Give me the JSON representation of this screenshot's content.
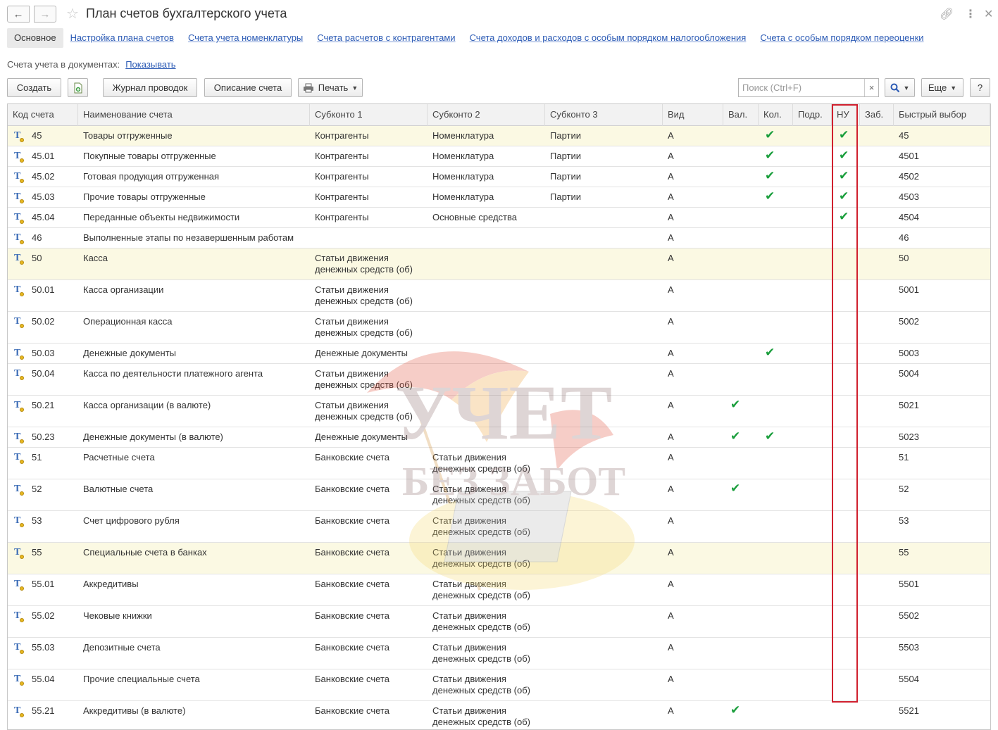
{
  "window": {
    "title": "План счетов бухгалтерского учета"
  },
  "tabs": [
    {
      "label": "Основное",
      "active": true
    },
    {
      "label": "Настройка плана счетов"
    },
    {
      "label": "Счета учета номенклатуры"
    },
    {
      "label": "Счета расчетов с контрагентами"
    },
    {
      "label": "Счета доходов и расходов с особым порядком налогообложения"
    },
    {
      "label": "Счета с особым порядком переоценки"
    }
  ],
  "accounts_in_docs": {
    "label": "Счета учета в документах:",
    "link": "Показывать"
  },
  "toolbar": {
    "create": "Создать",
    "journal": "Журнал проводок",
    "description": "Описание счета",
    "print": "Печать",
    "search_placeholder": "Поиск (Ctrl+F)",
    "more": "Еще",
    "help": "?"
  },
  "columns": [
    "Код счета",
    "Наименование счета",
    "Субконто 1",
    "Субконто 2",
    "Субконто 3",
    "Вид",
    "Вал.",
    "Кол.",
    "Подр.",
    "НУ",
    "Заб.",
    "Быстрый выбор"
  ],
  "rows": [
    {
      "code": "45",
      "name": "Товары отгруженные",
      "s1": "Контрагенты",
      "s2": "Номенклатура",
      "s3": "Партии",
      "kind": "А",
      "val": false,
      "qty": true,
      "nu": true,
      "quick": "45",
      "hl": true
    },
    {
      "code": "45.01",
      "name": "Покупные товары отгруженные",
      "s1": "Контрагенты",
      "s2": "Номенклатура",
      "s3": "Партии",
      "kind": "А",
      "val": false,
      "qty": true,
      "nu": true,
      "quick": "4501"
    },
    {
      "code": "45.02",
      "name": "Готовая продукция отгруженная",
      "s1": "Контрагенты",
      "s2": "Номенклатура",
      "s3": "Партии",
      "kind": "А",
      "val": false,
      "qty": true,
      "nu": true,
      "quick": "4502"
    },
    {
      "code": "45.03",
      "name": "Прочие товары отгруженные",
      "s1": "Контрагенты",
      "s2": "Номенклатура",
      "s3": "Партии",
      "kind": "А",
      "val": false,
      "qty": true,
      "nu": true,
      "quick": "4503"
    },
    {
      "code": "45.04",
      "name": "Переданные объекты недвижимости",
      "s1": "Контрагенты",
      "s2": "Основные средства",
      "s3": "",
      "kind": "А",
      "val": false,
      "qty": false,
      "nu": true,
      "quick": "4504"
    },
    {
      "code": "46",
      "name": "Выполненные этапы по незавершенным работам",
      "s1": "",
      "s2": "",
      "s3": "",
      "kind": "А",
      "val": false,
      "qty": false,
      "nu": false,
      "quick": "46"
    },
    {
      "code": "50",
      "name": "Касса",
      "s1": "Статьи движения\nденежных средств (об)",
      "s2": "",
      "s3": "",
      "kind": "А",
      "val": false,
      "qty": false,
      "nu": false,
      "quick": "50",
      "hl": true
    },
    {
      "code": "50.01",
      "name": "Касса организации",
      "s1": "Статьи движения\nденежных средств (об)",
      "s2": "",
      "s3": "",
      "kind": "А",
      "val": false,
      "qty": false,
      "nu": false,
      "quick": "5001"
    },
    {
      "code": "50.02",
      "name": "Операционная касса",
      "s1": "Статьи движения\nденежных средств (об)",
      "s2": "",
      "s3": "",
      "kind": "А",
      "val": false,
      "qty": false,
      "nu": false,
      "quick": "5002"
    },
    {
      "code": "50.03",
      "name": "Денежные документы",
      "s1": "Денежные документы",
      "s2": "",
      "s3": "",
      "kind": "А",
      "val": false,
      "qty": true,
      "nu": false,
      "quick": "5003"
    },
    {
      "code": "50.04",
      "name": "Касса по деятельности платежного агента",
      "s1": "Статьи движения\nденежных средств (об)",
      "s2": "",
      "s3": "",
      "kind": "А",
      "val": false,
      "qty": false,
      "nu": false,
      "quick": "5004"
    },
    {
      "code": "50.21",
      "name": "Касса организации (в валюте)",
      "s1": "Статьи движения\nденежных средств (об)",
      "s2": "",
      "s3": "",
      "kind": "А",
      "val": true,
      "qty": false,
      "nu": false,
      "quick": "5021"
    },
    {
      "code": "50.23",
      "name": "Денежные документы (в валюте)",
      "s1": "Денежные документы",
      "s2": "",
      "s3": "",
      "kind": "А",
      "val": true,
      "qty": true,
      "nu": false,
      "quick": "5023"
    },
    {
      "code": "51",
      "name": "Расчетные счета",
      "s1": "Банковские счета",
      "s2": "Статьи движения\nденежных средств (об)",
      "s3": "",
      "kind": "А",
      "val": false,
      "qty": false,
      "nu": false,
      "quick": "51"
    },
    {
      "code": "52",
      "name": "Валютные счета",
      "s1": "Банковские счета",
      "s2": "Статьи движения\nденежных средств (об)",
      "s3": "",
      "kind": "А",
      "val": true,
      "qty": false,
      "nu": false,
      "quick": "52"
    },
    {
      "code": "53",
      "name": "Счет цифрового рубля",
      "s1": "Банковские счета",
      "s2": "Статьи движения\nденежных средств (об)",
      "s3": "",
      "kind": "А",
      "val": false,
      "qty": false,
      "nu": false,
      "quick": "53"
    },
    {
      "code": "55",
      "name": "Специальные счета в банках",
      "s1": "Банковские счета",
      "s2": "Статьи движения\nденежных средств (об)",
      "s3": "",
      "kind": "А",
      "val": false,
      "qty": false,
      "nu": false,
      "quick": "55",
      "hl": true
    },
    {
      "code": "55.01",
      "name": "Аккредитивы",
      "s1": "Банковские счета",
      "s2": "Статьи движения\nденежных средств (об)",
      "s3": "",
      "kind": "А",
      "val": false,
      "qty": false,
      "nu": false,
      "quick": "5501"
    },
    {
      "code": "55.02",
      "name": "Чековые книжки",
      "s1": "Банковские счета",
      "s2": "Статьи движения\nденежных средств (об)",
      "s3": "",
      "kind": "А",
      "val": false,
      "qty": false,
      "nu": false,
      "quick": "5502"
    },
    {
      "code": "55.03",
      "name": "Депозитные счета",
      "s1": "Банковские счета",
      "s2": "Статьи движения\nденежных средств (об)",
      "s3": "",
      "kind": "А",
      "val": false,
      "qty": false,
      "nu": false,
      "quick": "5503"
    },
    {
      "code": "55.04",
      "name": "Прочие специальные счета",
      "s1": "Банковские счета",
      "s2": "Статьи движения\nденежных средств (об)",
      "s3": "",
      "kind": "А",
      "val": false,
      "qty": false,
      "nu": false,
      "quick": "5504"
    },
    {
      "code": "55.21",
      "name": "Аккредитивы (в валюте)",
      "s1": "Банковские счета",
      "s2": "Статьи движения\nденежных средств (об)",
      "s3": "",
      "kind": "А",
      "val": true,
      "qty": false,
      "nu": false,
      "quick": "5521"
    }
  ],
  "watermark": {
    "line1": "УЧЕТ",
    "line2": "БЕЗ ЗАБОТ"
  },
  "colors": {
    "link": "#2c5bb5",
    "highlight_row": "#fbf9e3",
    "check": "#1a9e3c",
    "red_frame": "#d0202e"
  }
}
